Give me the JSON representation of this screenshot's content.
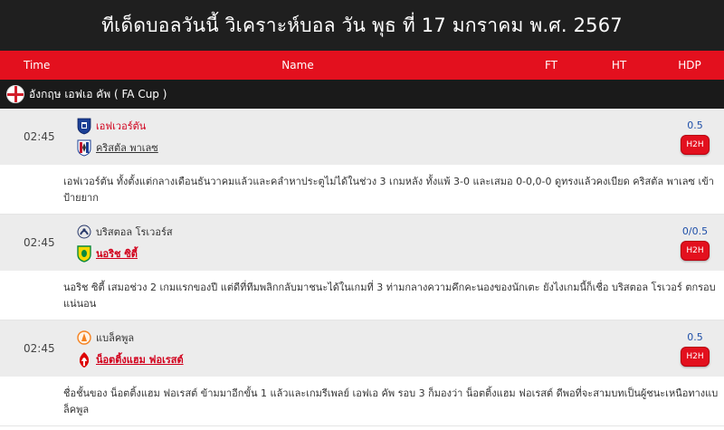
{
  "page": {
    "title": "ทีเด็ดบอลวันนี้ วิเคราะห์บอล วัน พุธ ที่ 17 มกราคม พ.ศ. 2567"
  },
  "columns": {
    "time": "Time",
    "name": "Name",
    "ft": "FT",
    "ht": "HT",
    "hdp": "HDP"
  },
  "league": {
    "name": "อังกฤษ เอฟเอ คัพ ( FA Cup )",
    "flag_icon": "england-flag-icon"
  },
  "matches": [
    {
      "time": "02:45",
      "home": {
        "name": "เอฟเวอร์ตัน",
        "crest_icon": "everton-crest-icon",
        "color": "#1b3f95"
      },
      "away": {
        "name": "คริสตัล พาเลซ",
        "crest_icon": "crystal-palace-crest-icon",
        "color": "#c4122e"
      },
      "hdp": "0.5",
      "h2h_label": "H2H",
      "note": "เอฟเวอร์ตัน ทั้งตั้งแต่กลางเดือนธันวาคมแล้วและคลำหาประตูไม่ได้ในช่วง 3 เกมหลัง ทั้งแพ้ 3-0 และเสมอ 0-0,0-0 ดูทรงแล้วคงเบียด คริสตัล พาเลซ เข้าป้ายยาก"
    },
    {
      "time": "02:45",
      "home": {
        "name": "บริสตอล โรเวอร์ส",
        "crest_icon": "bristol-rovers-crest-icon",
        "color": "#2a3a6b"
      },
      "away": {
        "name": "นอริช ซิตี้",
        "crest_icon": "norwich-crest-icon",
        "color": "#f5d800"
      },
      "hdp": "0/0.5",
      "h2h_label": "H2H",
      "note": "นอริช ซิตี้ เสมอช่วง 2 เกมแรกของปี แต่ดีที่ทีมพลิกกลับมาชนะได้ในเกมที่ 3 ท่ามกลางความคึกคะนองของนักเตะ ยังไงเกมนี้ก็เชื่อ บริสตอล โรเวอร์ ตกรอบแน่นอน"
    },
    {
      "time": "02:45",
      "home": {
        "name": "แบล็คพูล",
        "crest_icon": "blackpool-crest-icon",
        "color": "#f58220"
      },
      "away": {
        "name": "น็อตติ้งแฮม ฟอเรสต์",
        "crest_icon": "nottingham-forest-crest-icon",
        "color": "#dd0000"
      },
      "hdp": "0.5",
      "h2h_label": "H2H",
      "note": "ชื่อชั้นของ น็อตติ้งแฮม ฟอเรสต์ ข้ามมาอีกขั้น 1 แล้วและเกมรีเพลย์ เอฟเอ คัพ รอบ 3 ก็มองว่า น็อตติ้งแฮม ฟอเรสต์ ดีพอที่จะสามบทเป็นผู้ชนะเหนือทางแบล็คพูล"
    }
  ]
}
